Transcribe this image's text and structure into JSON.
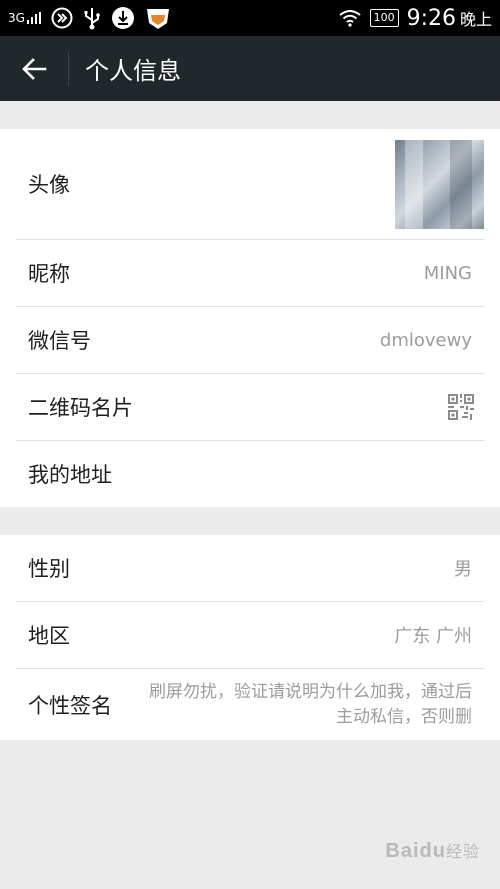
{
  "status_bar": {
    "network": "3G",
    "battery": "100",
    "time": "9:26",
    "ampm": "晚上"
  },
  "header": {
    "title": "个人信息"
  },
  "profile": {
    "avatar_label": "头像",
    "nickname_label": "昵称",
    "nickname_value": "MING",
    "wechat_id_label": "微信号",
    "wechat_id_value": "dmlovewy",
    "qrcode_label": "二维码名片",
    "address_label": "我的地址"
  },
  "details": {
    "gender_label": "性别",
    "gender_value": "男",
    "region_label": "地区",
    "region_value": "广东 广州",
    "signature_label": "个性签名",
    "signature_value": "刷屏勿扰，验证请说明为什么加我，通过后主动私信，否则删"
  },
  "watermark": {
    "brand": "Baidu",
    "suffix": "经验"
  }
}
